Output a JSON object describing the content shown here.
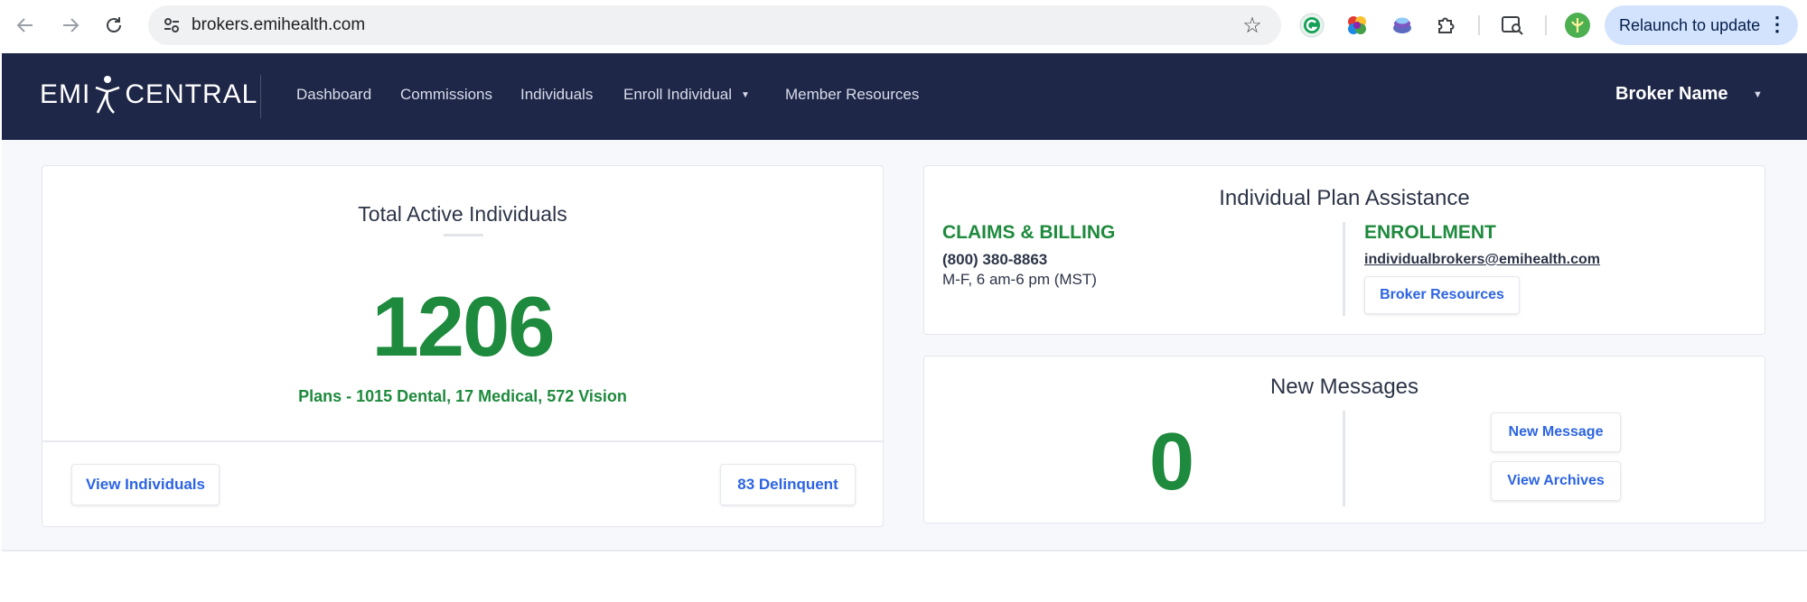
{
  "browser": {
    "url": "brokers.emihealth.com",
    "relaunch_label": "Relaunch to update"
  },
  "app": {
    "logo_left": "EMI",
    "logo_right": "CENTRAL",
    "nav": [
      "Dashboard",
      "Commissions",
      "Individuals",
      "Enroll Individual",
      "Member Resources"
    ],
    "user": "Broker Name"
  },
  "total_card": {
    "title": "Total Active Individuals",
    "count": "1206",
    "plans": "Plans - 1015 Dental, 17 Medical, 572 Vision",
    "view_button": "View Individuals",
    "delinquent_button": "83 Delinquent"
  },
  "assist_card": {
    "title": "Individual Plan Assistance",
    "claims_heading": "CLAIMS & BILLING",
    "claims_phone": "(800) 380-8863",
    "claims_hours": "M-F, 6 am-6 pm (MST)",
    "enroll_heading": "ENROLLMENT",
    "enroll_email": "individualbrokers@emihealth.com",
    "resources_button": "Broker Resources"
  },
  "messages_card": {
    "title": "New Messages",
    "count": "0",
    "new_button": "New Message",
    "archives_button": "View Archives"
  },
  "colors": {
    "navbar": "#1f2748",
    "accent_green": "#1e8a3d",
    "link_blue": "#2c64e3"
  }
}
